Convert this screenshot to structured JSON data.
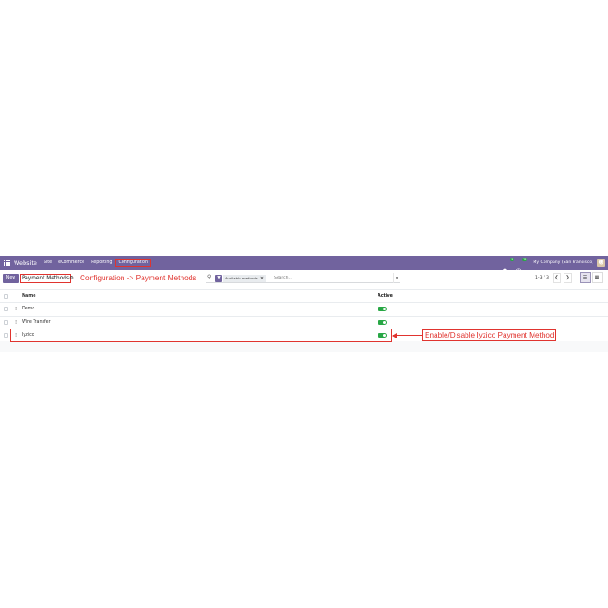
{
  "navbar": {
    "brand": "Website",
    "menu": [
      "Site",
      "eCommerce",
      "Reporting",
      "Configuration"
    ],
    "messages_badge": "5",
    "activity_badge": "26",
    "company": "My Company (San Francisco)"
  },
  "control": {
    "new_label": "New",
    "title": "Payment Methods",
    "search_facet": "Available methods",
    "search_placeholder": "Search...",
    "pager": "1-3 / 3"
  },
  "list": {
    "columns": [
      "Name",
      "Active"
    ],
    "rows": [
      {
        "name": "Demo",
        "active": true
      },
      {
        "name": "Wire Transfer",
        "active": true
      },
      {
        "name": "Iyzico",
        "active": true
      }
    ]
  },
  "annotations": {
    "config_path": "Configuration -> Payment Methods",
    "toggle_note": "Enable/Disable Iyzico Payment Method"
  },
  "colors": {
    "navbar": "#71639e",
    "accent_red": "#e0342f",
    "toggle_on": "#28a745"
  }
}
